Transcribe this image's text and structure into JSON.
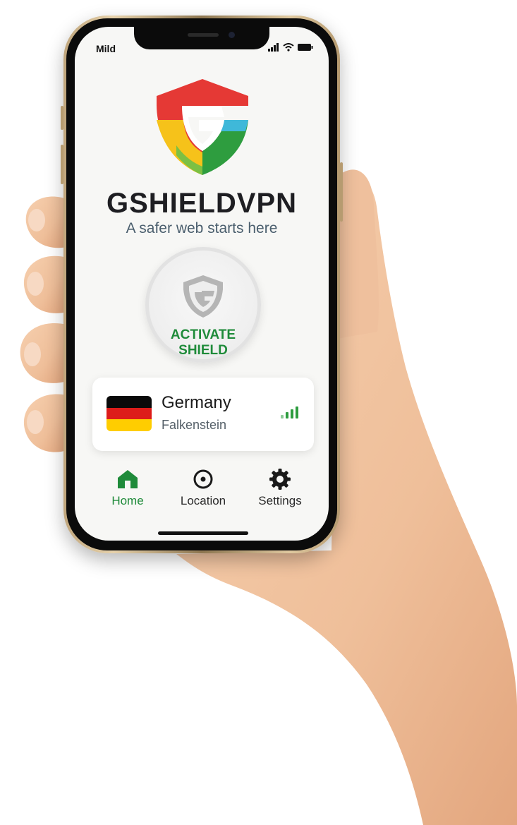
{
  "status_bar": {
    "time": "Mild"
  },
  "app": {
    "name": "GSHIELDVPN",
    "tagline": "A safer web starts here"
  },
  "connect_button": {
    "label": "ACTIVATE\nSHIELD",
    "state": "disconnected"
  },
  "server": {
    "country": "Germany",
    "city": "Falkenstein",
    "signal_bars": 3
  },
  "tabs": [
    {
      "label": "Home",
      "icon": "home-icon",
      "active": true
    },
    {
      "label": "Location",
      "icon": "location-target-icon",
      "active": false
    },
    {
      "label": "Settings",
      "icon": "gear-icon",
      "active": false
    }
  ],
  "colors": {
    "accent_green": "#1f8b3a",
    "logo_red": "#e53935",
    "logo_yellow": "#f6c21a",
    "logo_green": "#2e9d3f",
    "logo_cyan": "#3fb8d9",
    "flag": [
      "#0a0a0a",
      "#dd1c1a",
      "#ffcd00"
    ]
  }
}
